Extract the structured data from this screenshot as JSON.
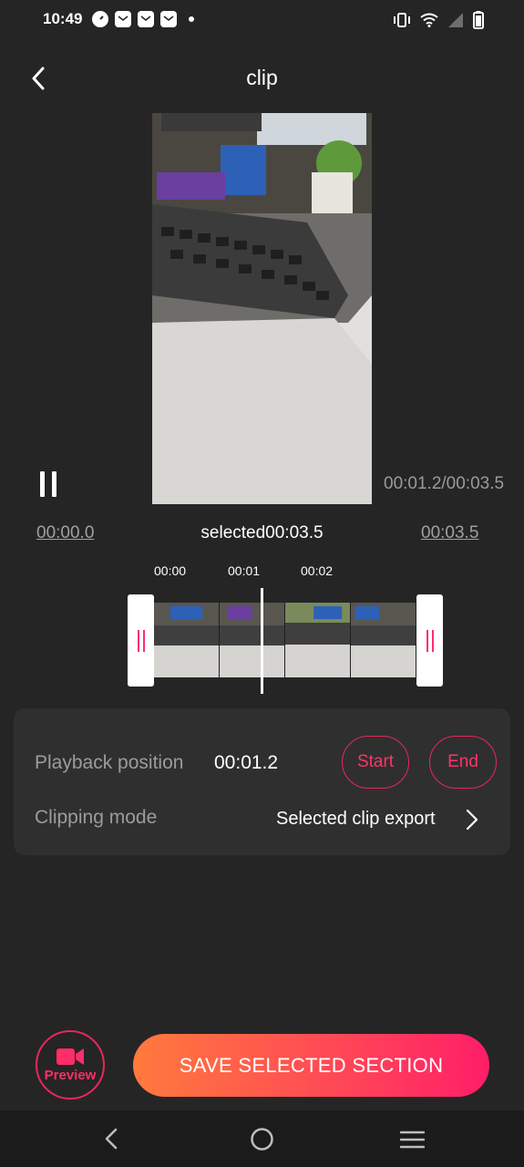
{
  "status_bar": {
    "time": "10:49",
    "left_icons": [
      "speed-icon",
      "mail-icon",
      "mail-icon",
      "mail-icon",
      "dot-icon"
    ],
    "right_icons": [
      "vibrate-icon",
      "wifi-icon",
      "signal-icon",
      "battery-icon"
    ]
  },
  "header": {
    "title": "clip",
    "back_icon": "chevron-left-icon"
  },
  "player": {
    "current_total": "00:01.2/00:03.5",
    "pause_icon": "pause-icon"
  },
  "range": {
    "start": "00:00.0",
    "selected": "selected00:03.5",
    "end": "00:03.5"
  },
  "timeline": {
    "ticks": [
      "00:00",
      "00:01",
      "00:02"
    ],
    "playhead_fraction": 0.34
  },
  "settings": {
    "playback_label": "Playback position",
    "playback_value": "00:01.2",
    "start_label": "Start",
    "end_label": "End",
    "mode_label": "Clipping mode",
    "mode_value": "Selected clip export"
  },
  "actions": {
    "preview_label": "Preview",
    "save_label": "SAVE SELECTED SECTION"
  },
  "colors": {
    "accent": "#ff2d6a",
    "background": "#252525",
    "card": "#2f2f2f"
  }
}
